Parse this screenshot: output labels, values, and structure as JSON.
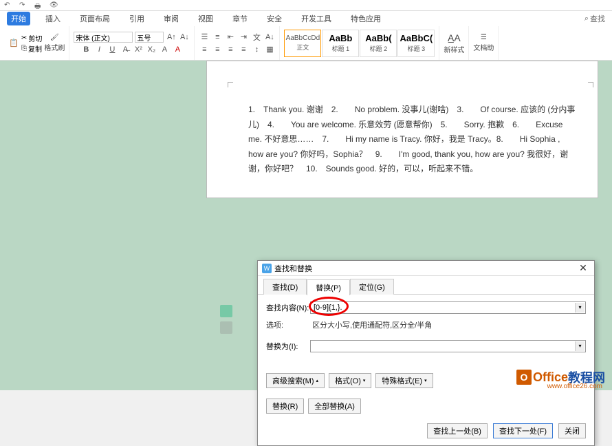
{
  "menu": {
    "tabs": [
      "开始",
      "插入",
      "页面布局",
      "引用",
      "审阅",
      "视图",
      "章节",
      "安全",
      "开发工具",
      "特色应用"
    ],
    "active": "开始",
    "search": "查找"
  },
  "ribbon": {
    "clipboard": {
      "cut": "剪切",
      "copy": "复制",
      "format_painter": "格式刷"
    },
    "font_name": "宋体 (正文)",
    "font_size": "五号",
    "styles": [
      {
        "preview": "AaBbCcDd",
        "label": "正文",
        "bold": false,
        "selected": true
      },
      {
        "preview": "AaBb",
        "label": "标题 1",
        "bold": true
      },
      {
        "preview": "AaBb(",
        "label": "标题 2",
        "bold": true
      },
      {
        "preview": "AaBbC(",
        "label": "标题 3",
        "bold": true
      }
    ],
    "new_style": "新样式",
    "doc_assist": "文档助"
  },
  "document": {
    "text": "1.　Thank you. 谢谢　2.　　No problem. 没事儿(谢啥)　3.　　Of course. 应该的 (分内事儿)　4.　　You are welcome. 乐意效劳 (愿意帮你)　5.　　Sorry. 抱歉　6.　　Excuse me. 不好意思……　7.　　Hi my name is Tracy. 你好，我是 Tracy。8.　　Hi Sophia , how are you? 你好吗，Sophia？　9.　　I'm good, thank you, how are you? 我很好，谢谢，你好吧？　10.　Sounds good. 好的，可以，听起来不错。"
  },
  "dialog": {
    "title": "查找和替换",
    "tabs": {
      "find": "查找(D)",
      "replace": "替换(P)",
      "goto": "定位(G)"
    },
    "find_label": "查找内容(N):",
    "find_value": "[0-9]{1,}.",
    "options_label": "选项:",
    "options_value": "区分大小写,使用通配符,区分全/半角",
    "replace_label": "替换为(I):",
    "replace_value": "",
    "advanced": "高级搜索(M)",
    "format": "格式(O)",
    "special": "特殊格式(E)",
    "replace_btn": "替换(R)",
    "replace_all": "全部替换(A)",
    "find_prev": "查找上一处(B)",
    "find_next": "查找下一处(F)",
    "close": "关闭"
  },
  "watermark": {
    "brand1": "Office",
    "brand2": "教程网",
    "url": "www.office26.com"
  }
}
